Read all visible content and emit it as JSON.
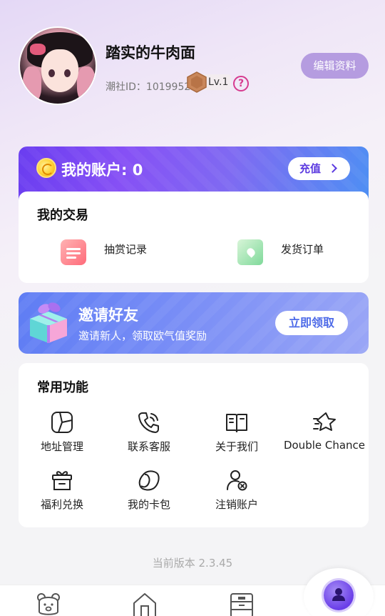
{
  "profile": {
    "nickname": "踏实的牛肉面",
    "id_label": "潮社ID：1019952",
    "level": "Lv.1",
    "help_glyph": "?",
    "edit_label": "编辑资料"
  },
  "account": {
    "title": "我的账户: 0",
    "recharge_label": "充值"
  },
  "trades": {
    "title": "我的交易",
    "items": [
      {
        "label": "抽赏记录",
        "icon": "reward-list-icon"
      },
      {
        "label": "发货订单",
        "icon": "shipping-box-icon"
      }
    ]
  },
  "invite": {
    "title": "邀请好友",
    "subtitle": "邀请新人，领取欧气值奖励",
    "button_label": "立即领取"
  },
  "functions": {
    "title": "常用功能",
    "items": [
      {
        "label": "地址管理",
        "icon": "map-icon"
      },
      {
        "label": "联系客服",
        "icon": "phone-icon"
      },
      {
        "label": "关于我们",
        "icon": "book-icon"
      },
      {
        "label": "Double Chance",
        "icon": "star-icon"
      },
      {
        "label": "福利兑换",
        "icon": "gift-box-icon"
      },
      {
        "label": "我的卡包",
        "icon": "card-wallet-icon"
      },
      {
        "label": "注销账户",
        "icon": "user-remove-icon"
      }
    ]
  },
  "version_label": "当前版本 2.3.45",
  "bottom_nav": [
    {
      "icon": "bear-icon"
    },
    {
      "icon": "home-icon"
    },
    {
      "icon": "cabinet-icon"
    },
    {
      "icon": "profile-icon"
    }
  ],
  "colors": {
    "accent_purple": "#6a3df0",
    "edit_button": "#b59ce0",
    "invite_blue": "#5f7df4",
    "help_pink": "#d63b8f"
  }
}
